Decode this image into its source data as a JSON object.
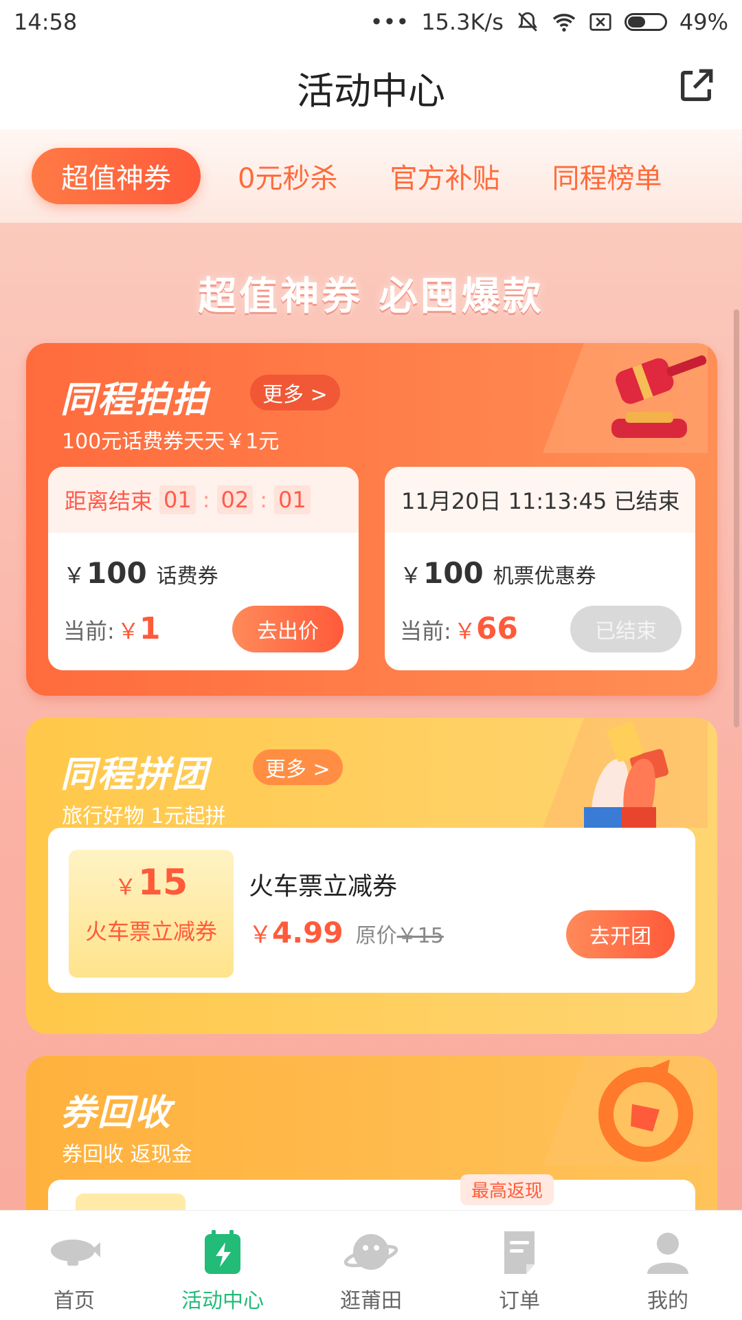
{
  "status_bar": {
    "time": "14:58",
    "dots": "•••",
    "speed": "15.3K/s",
    "battery": "49%"
  },
  "header": {
    "title": "活动中心"
  },
  "tabs": [
    {
      "label": "超值神券",
      "active": true
    },
    {
      "label": "0元秒杀",
      "active": false
    },
    {
      "label": "官方补贴",
      "active": false
    },
    {
      "label": "同程榜单",
      "active": false
    }
  ],
  "banner": {
    "text": "超值神券 必囤爆款"
  },
  "auction": {
    "title": "同程拍拍",
    "more": "更多 >",
    "subtitle": "100元话费券天天￥1元",
    "items": [
      {
        "countdown_label": "距离结束",
        "countdown": [
          "01",
          "02",
          "01"
        ],
        "currency": "￥",
        "amount": "100",
        "name": "话费券",
        "current_label": "当前:",
        "current_value": "1",
        "button": "去出价"
      },
      {
        "end_text": "11月20日 11:13:45 已结束",
        "currency": "￥",
        "amount": "100",
        "name": "机票优惠券",
        "current_label": "当前:",
        "current_value": "66",
        "button": "已结束"
      }
    ]
  },
  "group_buy": {
    "title": "同程拼团",
    "more": "更多 >",
    "subtitle": "旅行好物 1元起拼",
    "item": {
      "coupon_currency": "￥",
      "coupon_amount": "15",
      "coupon_name": "火车票立减券",
      "name": "火车票立减券",
      "price_currency": "￥",
      "price": "4.99",
      "original_label": "原价",
      "original_price": "￥15",
      "button": "去开团"
    }
  },
  "recycle": {
    "title": "券回收",
    "subtitle": "券回收 返现金",
    "badge": "最高返现"
  },
  "bottom_nav": [
    {
      "label": "首页",
      "icon": "blimp-icon",
      "active": false
    },
    {
      "label": "活动中心",
      "icon": "calendar-bolt-icon",
      "active": true
    },
    {
      "label": "逛莆田",
      "icon": "planet-mascot-icon",
      "active": false
    },
    {
      "label": "订单",
      "icon": "order-doc-icon",
      "active": false
    },
    {
      "label": "我的",
      "icon": "user-icon",
      "active": false
    }
  ],
  "colors": {
    "accent": "#ff5a3a",
    "nav_active": "#22bb77",
    "page_bg": "#fab2a4"
  }
}
